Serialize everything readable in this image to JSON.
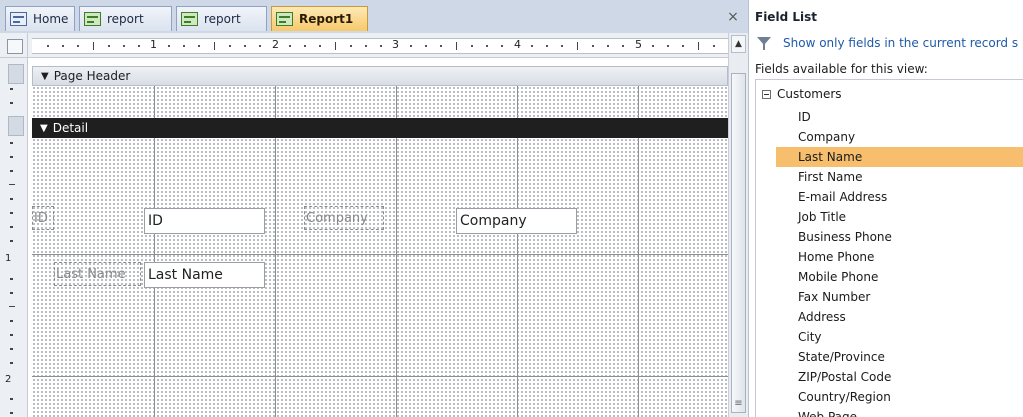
{
  "tabs": [
    {
      "label": "Home",
      "icon": "form-icon"
    },
    {
      "label": "report",
      "icon": "report-icon"
    },
    {
      "label": "report",
      "icon": "report-icon"
    },
    {
      "label": "Report1",
      "icon": "report-icon",
      "active": true
    }
  ],
  "close_symbol": "×",
  "ruler": {
    "numbers": [
      "1",
      "2",
      "3",
      "4",
      "5"
    ]
  },
  "vruler": {
    "numbers": [
      "1",
      "2"
    ]
  },
  "sections": {
    "page_header": "Page Header",
    "detail": "Detail"
  },
  "controls": {
    "id_label": "ID",
    "id_textbox": "ID",
    "company_label": "Company",
    "company_textbox": "Company",
    "lastname_label": "Last Name",
    "lastname_textbox": "Last Name"
  },
  "field_list": {
    "title": "Field List",
    "show_only_link": "Show only fields in the current record s",
    "available_label": "Fields available for this view:",
    "table": "Customers",
    "fields": [
      "ID",
      "Company",
      "Last Name",
      "First Name",
      "E-mail Address",
      "Job Title",
      "Business Phone",
      "Home Phone",
      "Mobile Phone",
      "Fax Number",
      "Address",
      "City",
      "State/Province",
      "ZIP/Postal Code",
      "Country/Region",
      "Web Page"
    ],
    "selected_field": "Last Name"
  },
  "colors": {
    "active_tab": "#f7c96b",
    "selection": "#f7be6d",
    "detail_bar": "#1f1f1f"
  }
}
